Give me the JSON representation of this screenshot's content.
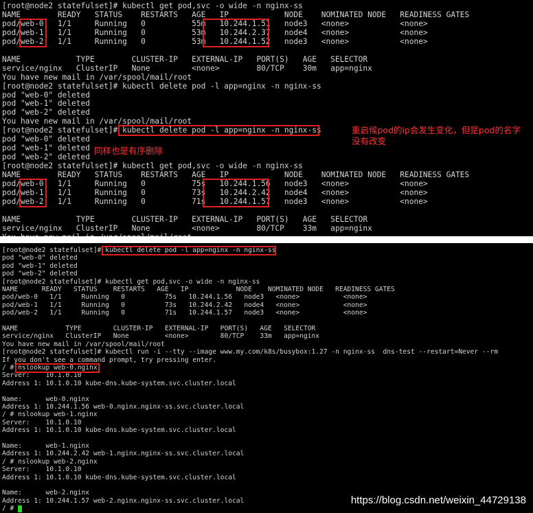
{
  "terminal1": {
    "lines": [
      "[root@node2 statefulset]# kubectl get pod,svc -o wide -n nginx-ss",
      "NAME        READY   STATUS    RESTARTS   AGE   IP            NODE    NOMINATED NODE   READINESS GATES",
      "pod/web-0   1/1     Running   0          55m   10.244.1.51   node3   <none>           <none>",
      "pod/web-1   1/1     Running   0          53m   10.244.2.37   node4   <none>           <none>",
      "pod/web-2   1/1     Running   0          53m   10.244.1.52   node3   <none>           <none>",
      "",
      "NAME            TYPE        CLUSTER-IP   EXTERNAL-IP   PORT(S)   AGE   SELECTOR",
      "service/nginx   ClusterIP   None         <none>        80/TCP    30m   app=nginx",
      "You have new mail in /var/spool/mail/root",
      "[root@node2 statefulset]# kubectl delete pod -l app=nginx -n nginx-ss",
      "pod \"web-0\" deleted",
      "pod \"web-1\" deleted",
      "pod \"web-2\" deleted",
      "You have new mail in /var/spool/mail/root",
      "[root@node2 statefulset]# kubectl delete pod -l app=nginx -n nginx-ss",
      "pod \"web-0\" deleted",
      "pod \"web-1\" deleted",
      "pod \"web-2\" deleted",
      "[root@node2 statefulset]# kubectl get pod,svc -o wide -n nginx-ss",
      "NAME        READY   STATUS    RESTARTS   AGE   IP            NODE    NOMINATED NODE   READINESS GATES",
      "pod/web-0   1/1     Running   0          75s   10.244.1.56   node3   <none>           <none>",
      "pod/web-1   1/1     Running   0          73s   10.244.2.42   node4   <none>           <none>",
      "pod/web-2   1/1     Running   0          71s   10.244.1.57   node3   <none>           <none>",
      "",
      "NAME            TYPE        CLUSTER-IP   EXTERNAL-IP   PORT(S)   AGE   SELECTOR",
      "service/nginx   ClusterIP   None         <none>        80/TCP    33m   app=nginx",
      "You have new mail in /var/spool/mail/root"
    ],
    "note_restart": "重启候pod的ip会发生变化，但是pod的名字\n没有改变",
    "note_order": "同样也是有序删除"
  },
  "terminal2": {
    "lines": [
      "[root@node2 statefulset]# kubectl delete pod -l app=nginx -n nginx-ss",
      "pod \"web-0\" deleted",
      "pod \"web-1\" deleted",
      "pod \"web-2\" deleted",
      "[root@node2 statefulset]# kubectl get pod,svc -o wide -n nginx-ss",
      "NAME      READY   STATUS    RESTARTS   AGE   IP            NODE    NOMINATED NODE   READINESS GATES",
      "pod/web-0   1/1     Running   0          75s   10.244.1.56   node3   <none>           <none>",
      "pod/web-1   1/1     Running   0          73s   10.244.2.42   node4   <none>           <none>",
      "pod/web-2   1/1     Running   0          71s   10.244.1.57   node3   <none>           <none>",
      "",
      "NAME            TYPE        CLUSTER-IP   EXTERNAL-IP   PORT(S)   AGE   SELECTOR",
      "service/nginx   ClusterIP   None         <none>        80/TCP    33m   app=nginx",
      "You have new mail in /var/spool/mail/root",
      "[root@node2 statefulset]# kubectl run -i --tty --image www.my.com/k8s/busybox:1.27 -n nginx-ss  dns-test --restart=Never --rm",
      "If you don't see a command prompt, try pressing enter.",
      "/ # nslookup web-0.nginx",
      "Server:    10.1.0.10",
      "Address 1: 10.1.0.10 kube-dns.kube-system.svc.cluster.local",
      "",
      "Name:      web-0.nginx",
      "Address 1: 10.244.1.56 web-0.nginx.nginx-ss.svc.cluster.local",
      "/ # nslookup web-1.nginx",
      "Server:    10.1.0.10",
      "Address 1: 10.1.0.10 kube-dns.kube-system.svc.cluster.local",
      "",
      "Name:      web-1.nginx",
      "Address 1: 10.244.2.42 web-1.nginx.nginx-ss.svc.cluster.local",
      "/ # nslookup web-2.nginx",
      "Server:    10.1.0.10",
      "Address 1: 10.1.0.10 kube-dns.kube-system.svc.cluster.local",
      "",
      "Name:      web-2.nginx",
      "Address 1: 10.244.1.57 web-2.nginx.nginx-ss.svc.cluster.local",
      "/ # "
    ]
  },
  "watermark": "https://blog.csdn.net/weixin_44729138"
}
